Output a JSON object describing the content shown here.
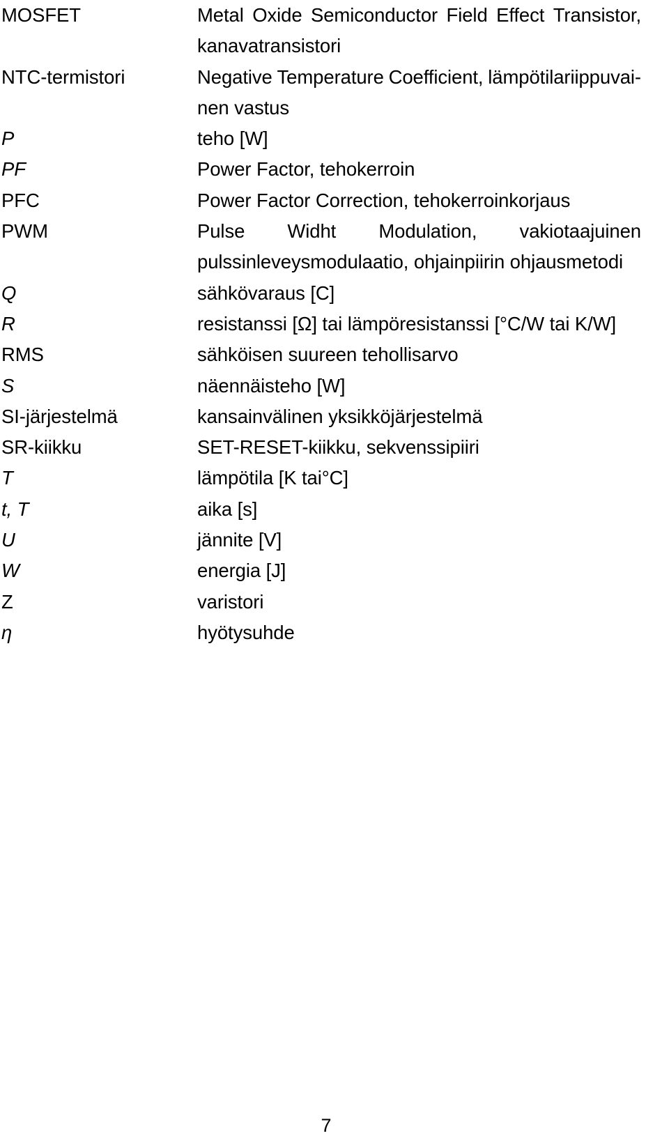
{
  "document": {
    "type": "glossary",
    "language": "fi",
    "page_number": "7"
  },
  "glossary": {
    "entries": [
      {
        "term": "MOSFET",
        "term_style": "regular",
        "definition": "Metal Oxide Semiconductor Field Effect Transistor, kanavatransistori",
        "lines": [
          "Metal Oxide Semiconductor Field Effect Transistor,",
          "kanavatransistori"
        ],
        "line_words": [
          [
            "Metal",
            "Oxide",
            "Semiconductor",
            "Field",
            "Effect",
            "Transistor,"
          ],
          [
            "kanavatransistori"
          ]
        ]
      },
      {
        "term": "NTC-termistori",
        "term_style": "regular",
        "definition": "Negative Temperature Coefficient, lämpötilariippuvainen vastus",
        "lines": [
          "Negative Temperature Coefficient, lämpötilariippuvai-",
          "nen vastus"
        ],
        "line_words": [
          [
            "Negative",
            "Temperature",
            "Coefficient,",
            "lämpötilariippuvai-"
          ],
          [
            "nen vastus"
          ]
        ]
      },
      {
        "term": "P",
        "term_style": "italic",
        "definition": "teho [W]",
        "lines": [
          "teho [W]"
        ],
        "line_words": [
          [
            "teho [W]"
          ]
        ]
      },
      {
        "term": "PF",
        "term_style": "italic",
        "definition": "Power Factor, tehokerroin",
        "lines": [
          "Power Factor, tehokerroin"
        ],
        "line_words": [
          [
            "Power Factor, tehokerroin"
          ]
        ]
      },
      {
        "term": "PFC",
        "term_style": "regular",
        "definition": "Power Factor Correction, tehokerroinkorjaus",
        "lines": [
          "Power Factor Correction, tehokerroinkorjaus"
        ],
        "line_words": [
          [
            "Power Factor Correction, tehokerroinkorjaus"
          ]
        ]
      },
      {
        "term": "PWM",
        "term_style": "regular",
        "definition": "Pulse Widht Modulation, vakiotaajuinen pulssinleveysmodulaatio, ohjainpiirin ohjausmetodi",
        "lines": [
          "Pulse Widht Modulation, vakiotaajuinen",
          "pulssinleveysmodulaatio, ohjainpiirin ohjausmetodi"
        ],
        "line_words": [
          [
            "Pulse",
            "Widht",
            "Modulation,",
            "vakiotaajuinen"
          ],
          [
            "pulssinleveysmodulaatio, ohjainpiirin ohjausmetodi"
          ]
        ]
      },
      {
        "term": "Q",
        "term_style": "italic",
        "definition": "sähkövaraus [C]",
        "lines": [
          "sähkövaraus [C]"
        ],
        "line_words": [
          [
            "sähkövaraus [C]"
          ]
        ]
      },
      {
        "term": "R",
        "term_style": "italic",
        "definition": "resistanssi [Ω] tai lämpöresistanssi [°C/W tai K/W]",
        "lines": [
          "resistanssi [Ω] tai lämpöresistanssi [°C/W tai K/W]"
        ],
        "line_words": [
          [
            "resistanssi [Ω] tai lämpöresistanssi [°C/W tai K/W]"
          ]
        ]
      },
      {
        "term": "RMS",
        "term_style": "regular",
        "definition": "sähköisen suureen tehollisarvo",
        "lines": [
          "sähköisen suureen tehollisarvo"
        ],
        "line_words": [
          [
            "sähköisen suureen tehollisarvo"
          ]
        ]
      },
      {
        "term": "S",
        "term_style": "italic",
        "definition": "näennäisteho [W]",
        "lines": [
          "näennäisteho [W]"
        ],
        "line_words": [
          [
            "näennäisteho [W]"
          ]
        ]
      },
      {
        "term": "SI-järjestelmä",
        "term_style": "regular",
        "definition": "kansainvälinen yksikköjärjestelmä",
        "lines": [
          "kansainvälinen yksikköjärjestelmä"
        ],
        "line_words": [
          [
            "kansainvälinen yksikköjärjestelmä"
          ]
        ]
      },
      {
        "term": "SR-kiikku",
        "term_style": "regular",
        "definition": "SET-RESET-kiikku, sekvenssipiiri",
        "lines": [
          "SET-RESET-kiikku, sekvenssipiiri"
        ],
        "line_words": [
          [
            "SET-RESET-kiikku, sekvenssipiiri"
          ]
        ]
      },
      {
        "term": "T",
        "term_style": "italic",
        "definition": "lämpötila [K tai°C]",
        "lines": [
          "lämpötila [K tai°C]"
        ],
        "line_words": [
          [
            "lämpötila [K tai°C]"
          ]
        ]
      },
      {
        "term": "t, T",
        "term_style": "italic",
        "definition": "aika [s]",
        "lines": [
          "aika [s]"
        ],
        "line_words": [
          [
            "aika [s]"
          ]
        ]
      },
      {
        "term": "U",
        "term_style": "italic",
        "definition": "jännite [V]",
        "lines": [
          "jännite [V]"
        ],
        "line_words": [
          [
            "jännite [V]"
          ]
        ]
      },
      {
        "term": "W",
        "term_style": "italic",
        "definition": "energia [J]",
        "lines": [
          "energia [J]"
        ],
        "line_words": [
          [
            "energia [J]"
          ]
        ]
      },
      {
        "term": "Z",
        "term_style": "regular",
        "definition": "varistori",
        "lines": [
          "varistori"
        ],
        "line_words": [
          [
            "varistori"
          ]
        ]
      },
      {
        "term": "η",
        "term_style": "italic",
        "definition": "hyötysuhde",
        "lines": [
          "hyötysuhde"
        ],
        "line_words": [
          [
            "hyötysuhde"
          ]
        ]
      }
    ]
  }
}
